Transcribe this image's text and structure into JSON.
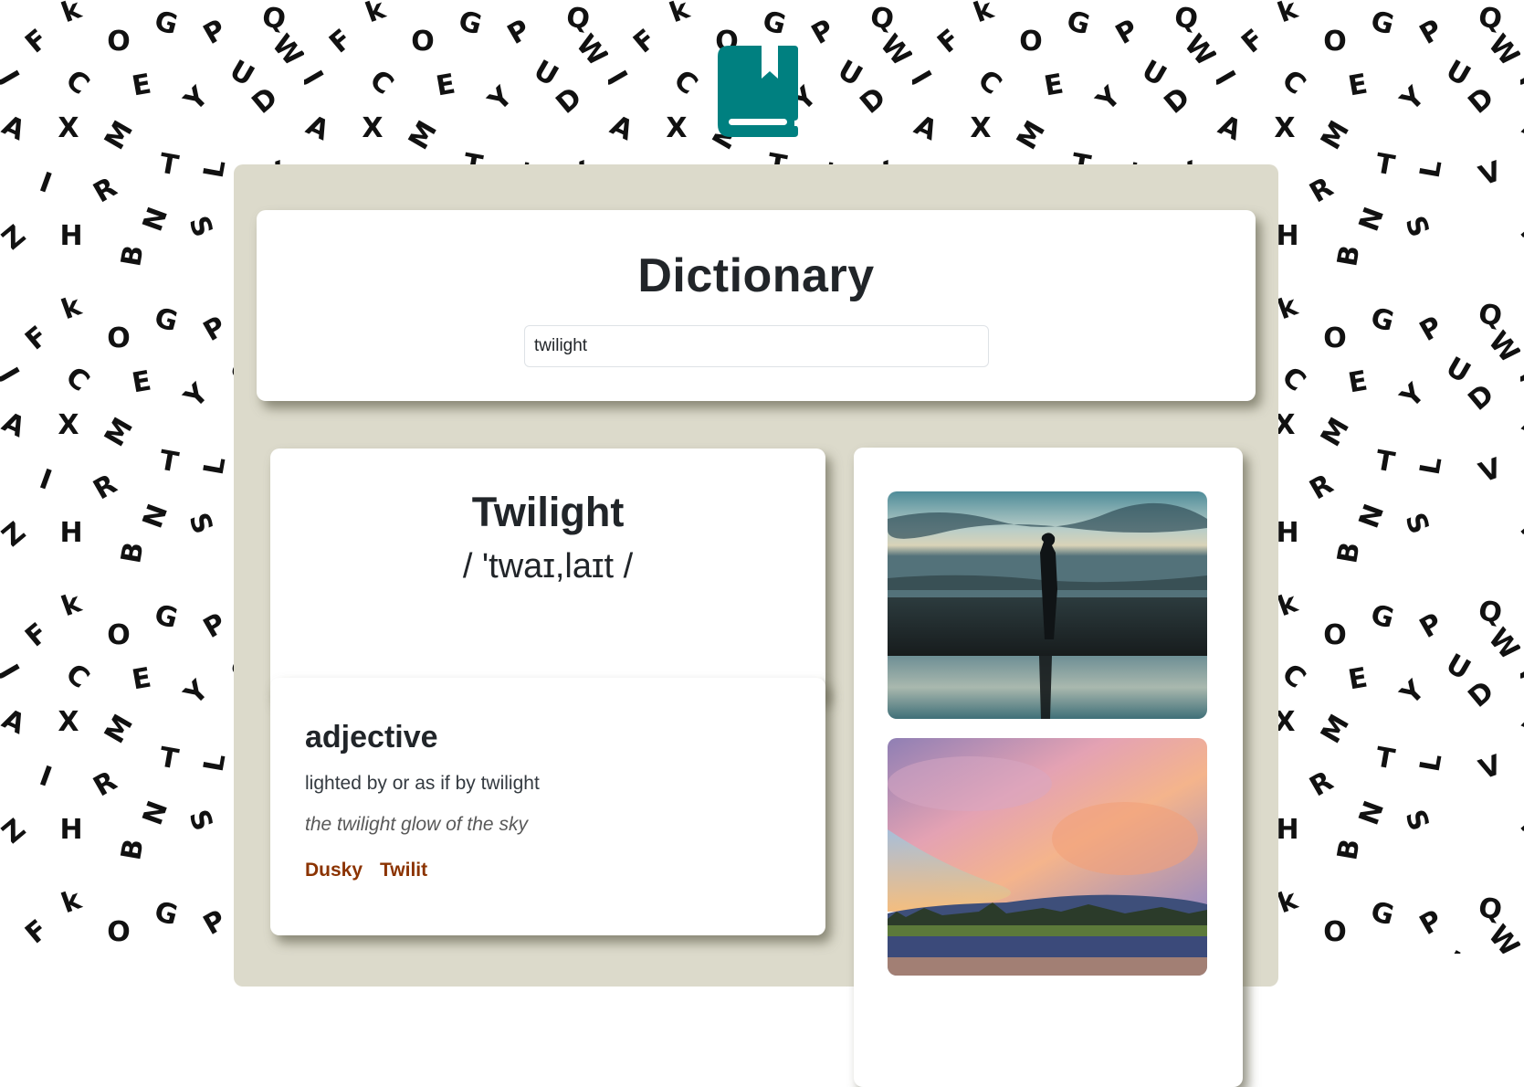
{
  "app": {
    "logo_icon": "book-bookmark-icon",
    "brand_color": "#008080",
    "panel_color": "#dcdacb",
    "synonym_color": "#8b3300"
  },
  "header": {
    "title": "Dictionary",
    "search": {
      "value": "twilight",
      "placeholder": ""
    }
  },
  "entry": {
    "word": "Twilight",
    "phonetic": "/ 'twaɪ,laɪt /",
    "meanings": [
      {
        "part_of_speech": "adjective",
        "definition": "lighted by or as if by twilight",
        "example": "the twilight glow of the sky",
        "synonyms": [
          "Dusky",
          "Twilit"
        ]
      }
    ]
  },
  "images": [
    {
      "alt": "silhouette of a person standing on a beach at twilight with reflection"
    },
    {
      "alt": "pink and orange clouds over a lake and hills at sunset"
    }
  ],
  "background": {
    "letters": [
      "k",
      "O",
      "G",
      "P",
      "Q",
      "F",
      "J",
      "C",
      "E",
      "Y",
      "U",
      "A",
      "X",
      "M",
      "T",
      "L",
      "I",
      "R",
      "N",
      "S",
      "Z",
      "H",
      "B",
      "D",
      "W",
      "V"
    ]
  }
}
